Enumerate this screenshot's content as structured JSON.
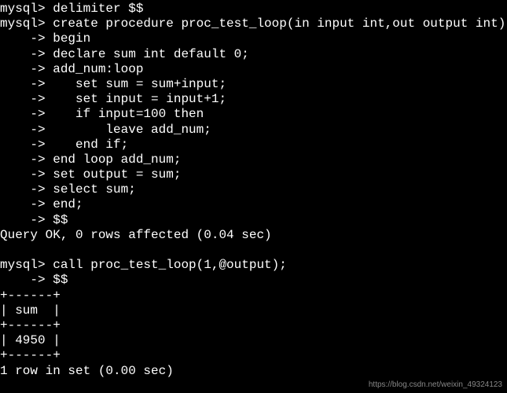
{
  "lines": [
    "mysql> delimiter $$",
    "mysql> create procedure proc_test_loop(in input int,out output int)",
    "    -> begin",
    "    -> declare sum int default 0;",
    "    -> add_num:loop",
    "    ->    set sum = sum+input;",
    "    ->    set input = input+1;",
    "    ->    if input=100 then",
    "    ->        leave add_num;",
    "    ->    end if;",
    "    -> end loop add_num;",
    "    -> set output = sum;",
    "    -> select sum;",
    "    -> end;",
    "    -> $$",
    "Query OK, 0 rows affected (0.04 sec)",
    "",
    "mysql> call proc_test_loop(1,@output);",
    "    -> $$",
    "+------+",
    "| sum  |",
    "+------+",
    "| 4950 |",
    "+------+",
    "1 row in set (0.00 sec)"
  ],
  "watermark": "https://blog.csdn.net/weixin_49324123"
}
